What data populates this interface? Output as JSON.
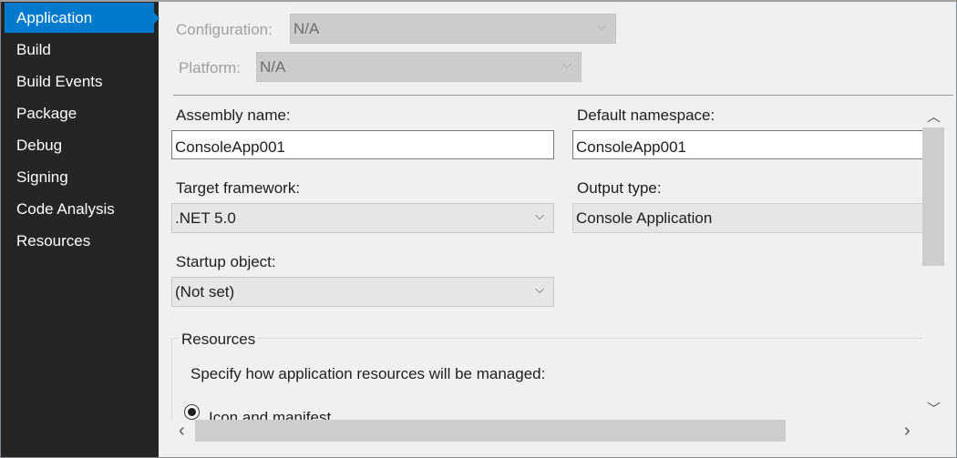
{
  "sidebar": {
    "items": [
      {
        "label": "Application",
        "active": true
      },
      {
        "label": "Build"
      },
      {
        "label": "Build Events"
      },
      {
        "label": "Package"
      },
      {
        "label": "Debug"
      },
      {
        "label": "Signing"
      },
      {
        "label": "Code Analysis"
      },
      {
        "label": "Resources"
      }
    ]
  },
  "header": {
    "configuration_label": "Configuration:",
    "configuration_value": "N/A",
    "platform_label": "Platform:",
    "platform_value": "N/A"
  },
  "form": {
    "assembly_name_label": "Assembly name:",
    "assembly_name_value": "ConsoleApp001",
    "default_namespace_label": "Default namespace:",
    "default_namespace_value": "ConsoleApp001",
    "target_framework_label": "Target framework:",
    "target_framework_value": ".NET 5.0",
    "output_type_label": "Output type:",
    "output_type_value": "Console Application",
    "startup_object_label": "Startup object:",
    "startup_object_value": "(Not set)"
  },
  "resources": {
    "title": "Resources",
    "description": "Specify how application resources will be managed:",
    "option_icon_manifest": "Icon and manifest"
  },
  "icons": {
    "chevron": "⌵",
    "scroll_up": "︿",
    "scroll_down": "﹀",
    "scroll_left": "‹",
    "scroll_right": "›"
  }
}
